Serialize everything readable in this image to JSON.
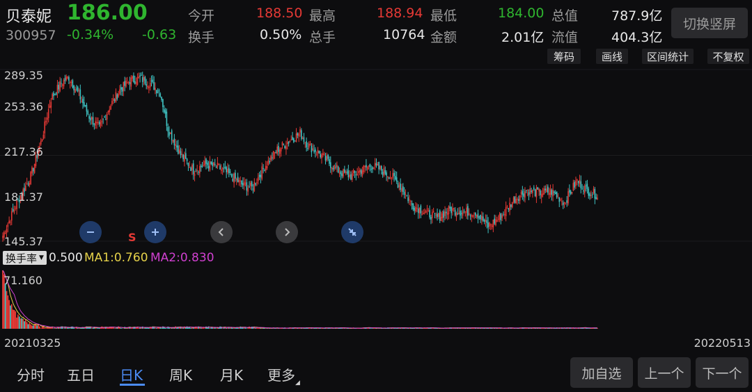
{
  "stock": {
    "name": "贝泰妮",
    "code": "300957",
    "price": "186.00",
    "change_pct": "-0.34%",
    "change": "-0.63"
  },
  "quote": {
    "open_label": "今开",
    "open": "188.50",
    "high_label": "最高",
    "high": "188.94",
    "low_label": "最低",
    "low": "184.00",
    "total_mv_label": "总值",
    "total_mv": "787.9亿",
    "turnover_label": "换手",
    "turnover": "0.50%",
    "volume_label": "总手",
    "volume": "10764",
    "amount_label": "金额",
    "amount": "2.01亿",
    "float_mv_label": "流值",
    "float_mv": "404.3亿"
  },
  "switch_button": "切换竖屏",
  "toolbar": {
    "chips": "筹码",
    "draw": "画线",
    "range_stats": "区间统计",
    "adjust": "不复权"
  },
  "price_axis": {
    "labels": [
      "289.35",
      "253.36",
      "217.36",
      "181.37",
      "145.37"
    ]
  },
  "marker_s": "S",
  "indicator": {
    "selector": "换手率",
    "value": "0.500",
    "ma1_label": "MA1:0.760",
    "ma2_label": "MA2:0.830",
    "max_label": "71.160"
  },
  "dates": {
    "start": "20210325",
    "end": "20220513"
  },
  "period_tabs": [
    "分时",
    "五日",
    "日K",
    "周K",
    "月K",
    "更多"
  ],
  "active_tab_index": 2,
  "actions": {
    "add_watch": "加自选",
    "prev": "上一个",
    "next": "下一个"
  },
  "colors": {
    "up": "#e53935",
    "down": "#40c4c4",
    "ma1": "#e6d24a",
    "ma2": "#d040d0",
    "active_tab": "#4c8cf5"
  },
  "chart_data": {
    "type": "candlestick",
    "title": "",
    "y_axis": {
      "ticks": [
        289.35,
        253.36,
        217.36,
        181.37,
        145.37
      ],
      "range": [
        145.37,
        289.35
      ]
    },
    "x_range": [
      "20210325",
      "20220513"
    ],
    "anchors_close": [
      [
        0,
        150
      ],
      [
        10,
        175
      ],
      [
        22,
        200
      ],
      [
        30,
        228
      ],
      [
        38,
        265
      ],
      [
        46,
        278
      ],
      [
        52,
        283
      ],
      [
        60,
        268
      ],
      [
        68,
        250
      ],
      [
        76,
        240
      ],
      [
        84,
        258
      ],
      [
        92,
        272
      ],
      [
        100,
        280
      ],
      [
        108,
        282
      ],
      [
        116,
        278
      ],
      [
        124,
        270
      ],
      [
        130,
        240
      ],
      [
        140,
        218
      ],
      [
        150,
        205
      ],
      [
        160,
        210
      ],
      [
        170,
        207
      ],
      [
        180,
        200
      ],
      [
        188,
        193
      ],
      [
        196,
        190
      ],
      [
        206,
        208
      ],
      [
        216,
        222
      ],
      [
        226,
        230
      ],
      [
        234,
        236
      ],
      [
        240,
        226
      ],
      [
        248,
        220
      ],
      [
        258,
        210
      ],
      [
        266,
        203
      ],
      [
        274,
        200
      ],
      [
        282,
        205
      ],
      [
        290,
        209
      ],
      [
        298,
        205
      ],
      [
        306,
        200
      ],
      [
        314,
        190
      ],
      [
        322,
        176
      ],
      [
        332,
        170
      ],
      [
        342,
        165
      ],
      [
        352,
        172
      ],
      [
        362,
        170
      ],
      [
        372,
        170
      ],
      [
        382,
        158
      ],
      [
        392,
        166
      ],
      [
        402,
        180
      ],
      [
        412,
        188
      ],
      [
        422,
        186
      ],
      [
        432,
        187
      ],
      [
        442,
        178
      ],
      [
        452,
        196
      ],
      [
        460,
        188
      ],
      [
        468,
        184
      ]
    ],
    "turnover": {
      "first_value": 71.16,
      "last_value": 0.5,
      "ma1_last": 0.76,
      "ma2_last": 0.83
    }
  }
}
